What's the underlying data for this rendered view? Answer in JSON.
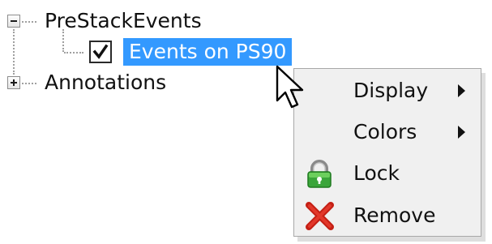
{
  "tree": {
    "root_label": "PreStackEvents",
    "child_label": "Events on PS90",
    "child_checked": true,
    "sibling_label": "Annotations",
    "root_expander_icon": "minus-box-icon",
    "sibling_expander_icon": "plus-box-icon",
    "selection_color": "#3399ff"
  },
  "context_menu": {
    "items": [
      {
        "label": "Display",
        "has_submenu": true
      },
      {
        "label": "Colors",
        "has_submenu": true
      },
      {
        "label": "Lock",
        "icon": "padlock-icon"
      },
      {
        "label": "Remove",
        "icon": "red-x-icon"
      }
    ]
  },
  "cursor": {
    "icon": "arrow-cursor-icon"
  }
}
